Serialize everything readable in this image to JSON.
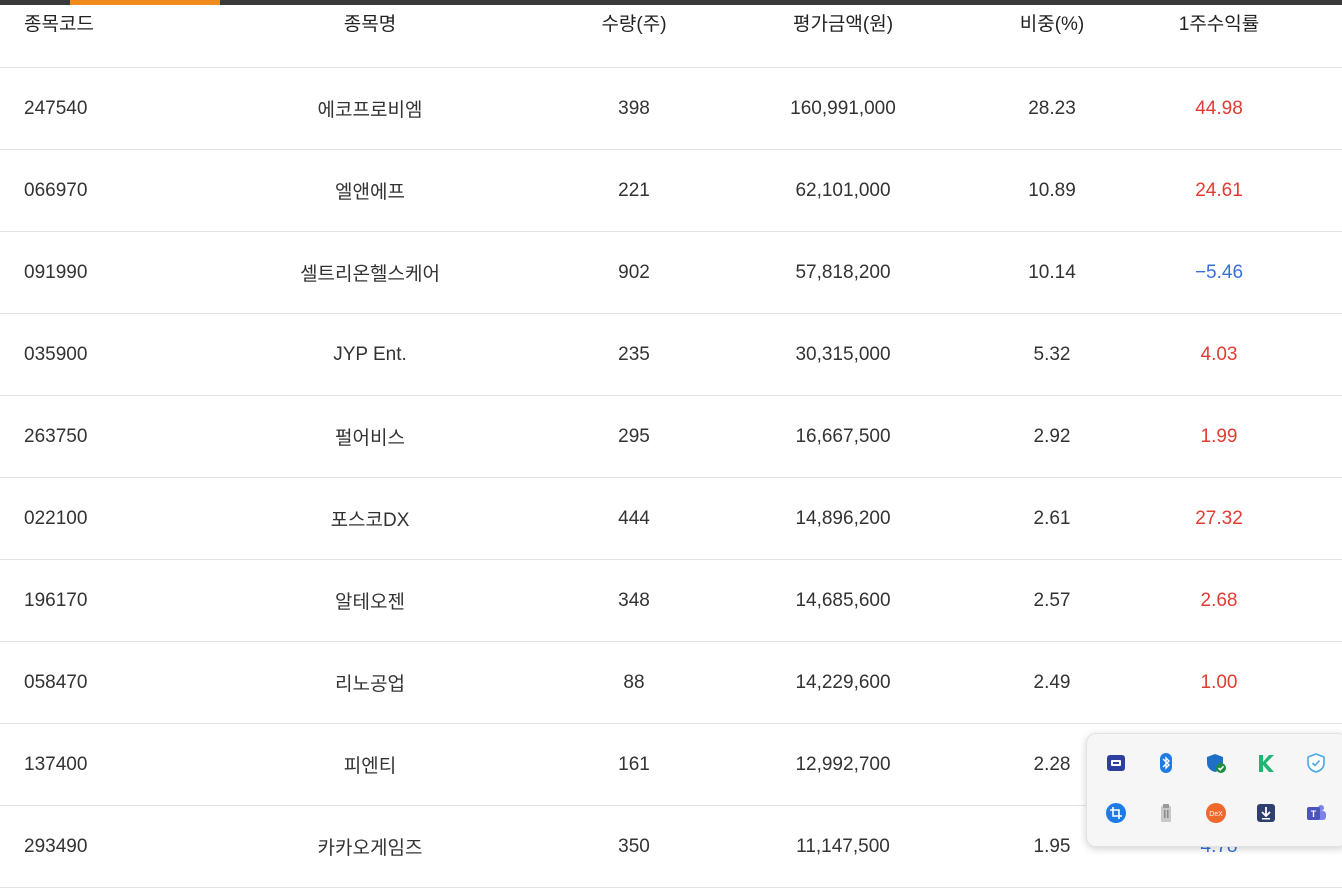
{
  "headers": [
    "종목코드",
    "종목명",
    "수량(주)",
    "평가금액(원)",
    "비중(%)",
    "1주수익률"
  ],
  "rows": [
    {
      "code": "247540",
      "name": "에코프로비엠",
      "qty": "398",
      "value": "160,991,000",
      "weight": "28.23",
      "ret": "44.98",
      "dir": "up"
    },
    {
      "code": "066970",
      "name": "엘앤에프",
      "qty": "221",
      "value": "62,101,000",
      "weight": "10.89",
      "ret": "24.61",
      "dir": "up"
    },
    {
      "code": "091990",
      "name": "셀트리온헬스케어",
      "qty": "902",
      "value": "57,818,200",
      "weight": "10.14",
      "ret": "−5.46",
      "dir": "down"
    },
    {
      "code": "035900",
      "name": "JYP Ent.",
      "qty": "235",
      "value": "30,315,000",
      "weight": "5.32",
      "ret": "4.03",
      "dir": "up"
    },
    {
      "code": "263750",
      "name": "펄어비스",
      "qty": "295",
      "value": "16,667,500",
      "weight": "2.92",
      "ret": "1.99",
      "dir": "up"
    },
    {
      "code": "022100",
      "name": "포스코DX",
      "qty": "444",
      "value": "14,896,200",
      "weight": "2.61",
      "ret": "27.32",
      "dir": "up"
    },
    {
      "code": "196170",
      "name": "알테오젠",
      "qty": "348",
      "value": "14,685,600",
      "weight": "2.57",
      "ret": "2.68",
      "dir": "up"
    },
    {
      "code": "058470",
      "name": "리노공업",
      "qty": "88",
      "value": "14,229,600",
      "weight": "2.49",
      "ret": "1.00",
      "dir": "up"
    },
    {
      "code": "137400",
      "name": "피엔티",
      "qty": "161",
      "value": "12,992,700",
      "weight": "2.28",
      "ret": "",
      "dir": "up"
    },
    {
      "code": "293490",
      "name": "카카오게임즈",
      "qty": "350",
      "value": "11,147,500",
      "weight": "1.95",
      "ret": "4.78",
      "dir": "down"
    }
  ],
  "tray": {
    "icons": [
      "app-window-icon",
      "bluetooth-icon",
      "defender-shield-icon",
      "kaspersky-icon",
      "security-shield-icon",
      "crop-tool-icon",
      "usb-device-icon",
      "dex-icon",
      "download-icon",
      "teams-icon"
    ],
    "dex_label": "DeX",
    "teams_label": "T"
  },
  "colors": {
    "up": "#e03c32",
    "down": "#3870d8",
    "accent": "#f08a1c"
  }
}
